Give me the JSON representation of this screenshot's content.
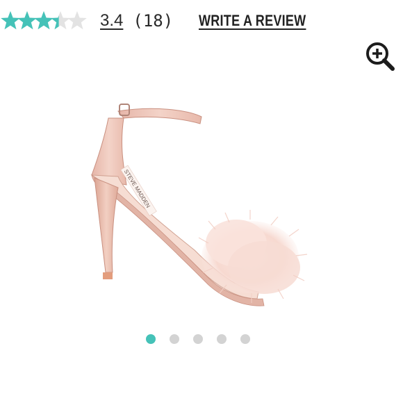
{
  "rating": {
    "value": "3.4",
    "count": "(18)",
    "stars_filled_fraction": 0.68,
    "star_total": 5,
    "star_color": "#45c2b8",
    "empty_star_color": "#e3e3e3"
  },
  "review": {
    "write_label": "WRITE A REVIEW"
  },
  "zoom": {
    "icon": "zoom-in-icon"
  },
  "carousel": {
    "total": 5,
    "active_index": 0,
    "active_color": "#45c2b8",
    "inactive_color": "#d3d3d3"
  },
  "product": {
    "image_brand_text": "STEVE MADDEN"
  }
}
